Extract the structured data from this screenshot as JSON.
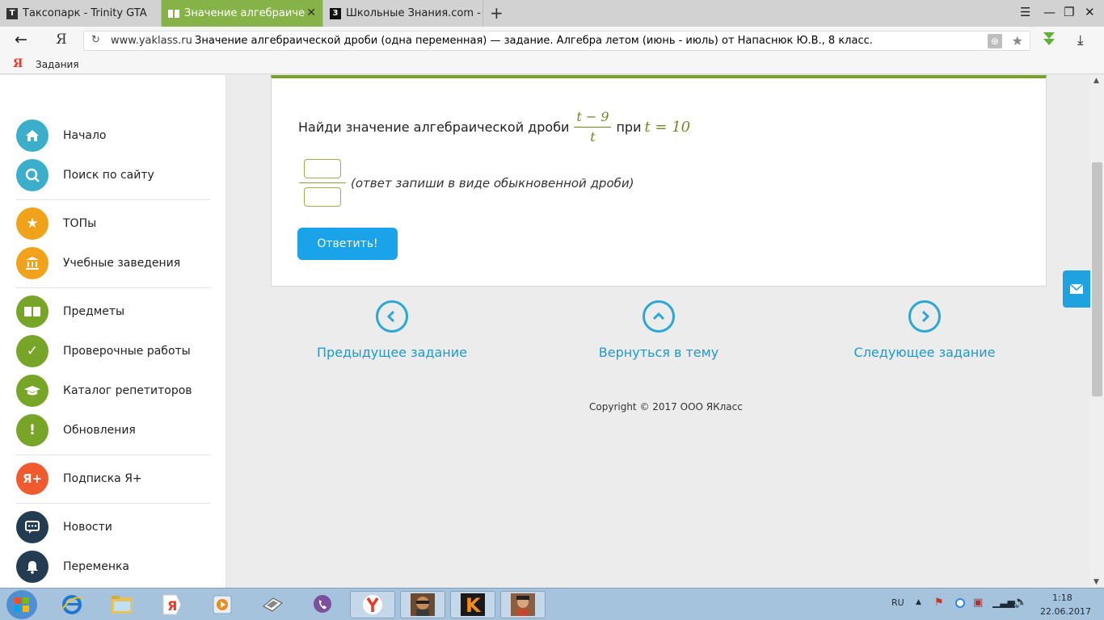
{
  "browser": {
    "tabs": [
      {
        "title": "Таксопарк - Trinity GTA",
        "favicon": "T",
        "active": false
      },
      {
        "title": "Значение алгебраическо",
        "favicon": "book-icon",
        "active": true
      },
      {
        "title": "Школьные Знания.com - Ре",
        "favicon": "3",
        "active": false
      }
    ],
    "address": {
      "host": "www.yaklass.ru",
      "page_title": "Значение алгебраической дроби (одна переменная) — задание. Алгебра летом (июнь - июль) от Напаснюк Ю.В., 8 класс."
    },
    "yandex_logo": "Я",
    "bookmarks": [
      {
        "label": "Задания"
      }
    ]
  },
  "sidebar": {
    "items": [
      {
        "label": "Начало",
        "icon": "home-icon",
        "color": "#3aaecb"
      },
      {
        "label": "Поиск по сайту",
        "icon": "search-icon",
        "color": "#3aaecb"
      },
      {
        "label": "ТОПы",
        "icon": "star-icon",
        "color": "#f0a21b"
      },
      {
        "label": "Учебные заведения",
        "icon": "institution-icon",
        "color": "#f0a21b"
      },
      {
        "label": "Предметы",
        "icon": "book-icon",
        "color": "#77a528"
      },
      {
        "label": "Проверочные работы",
        "icon": "check-icon",
        "color": "#77a528"
      },
      {
        "label": "Каталог репетиторов",
        "icon": "graduation-cap-icon",
        "color": "#77a528"
      },
      {
        "label": "Обновления",
        "icon": "exclamation-icon",
        "color": "#77a528"
      },
      {
        "label": "Подписка Я+",
        "icon": "ya-plus-icon",
        "color": "#ef5b2e"
      },
      {
        "label": "Новости",
        "icon": "chat-icon",
        "color": "#233c52"
      },
      {
        "label": "Переменка",
        "icon": "bell-icon",
        "color": "#233c52"
      }
    ],
    "ya_plus_glyph": "Я+",
    "exclamation_glyph": "!"
  },
  "task": {
    "prompt": "Найди значение алгебраической дроби",
    "fraction_numerator": "t − 9",
    "fraction_denominator": "t",
    "at_word": "при",
    "condition": "t = 10",
    "answer_hint": "(ответ запиши в виде обыкновенной дроби)",
    "submit_label": "Ответить!",
    "accent_color": "#75a227"
  },
  "navigation": {
    "prev": "Предыдущее задание",
    "up": "Вернуться в тему",
    "next": "Следующее задание"
  },
  "footer": {
    "copyright": "Copyright © 2017 ООО ЯКласс"
  },
  "taskbar": {
    "lang": "RU",
    "time": "1:18",
    "date": "22.06.2017",
    "apps": [
      "windows-start-icon",
      "internet-explorer-icon",
      "file-explorer-icon",
      "yandex-browser-icon",
      "media-player-icon",
      "network-icon",
      "viber-icon",
      "yandex-icon",
      "game-gta-icon",
      "game-k-icon",
      "game-avatar-icon"
    ],
    "yandex_glyph": "Я",
    "k_glyph": "K"
  }
}
